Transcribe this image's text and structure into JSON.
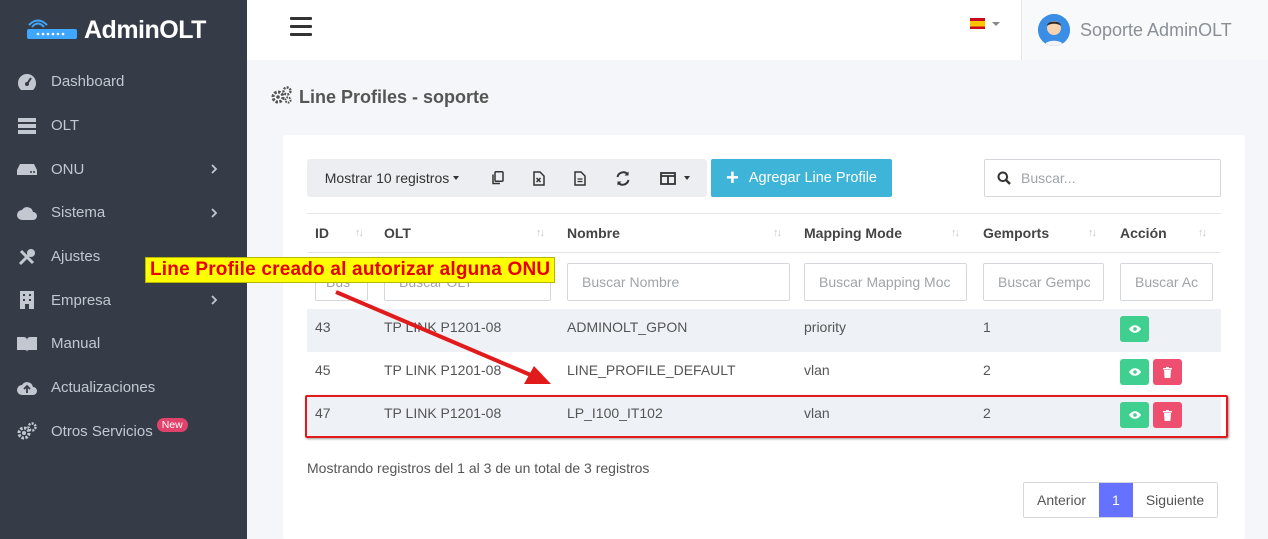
{
  "brand": {
    "name": "AdminOLT"
  },
  "sidebar": {
    "items": [
      {
        "label": "Dashboard",
        "icon": "dashboard-icon",
        "has_children": false
      },
      {
        "label": "OLT",
        "icon": "server-icon",
        "has_children": false
      },
      {
        "label": "ONU",
        "icon": "router-icon",
        "has_children": true
      },
      {
        "label": "Sistema",
        "icon": "cloud-icon",
        "has_children": true
      },
      {
        "label": "Ajustes",
        "icon": "tools-icon",
        "has_children": false
      },
      {
        "label": "Empresa",
        "icon": "building-icon",
        "has_children": true
      },
      {
        "label": "Manual",
        "icon": "book-icon",
        "has_children": false
      },
      {
        "label": "Actualizaciones",
        "icon": "cloud-upload-icon",
        "has_children": false
      },
      {
        "label": "Otros Servicios",
        "icon": "cogs-icon",
        "has_children": false,
        "badge": "New"
      }
    ]
  },
  "header": {
    "language": "es",
    "user_name": "Soporte AdminOLT"
  },
  "page": {
    "title": "Line Profiles - soporte"
  },
  "toolbar": {
    "show_records": "Mostrar 10 registros",
    "add_button": "Agregar Line Profile",
    "search_placeholder": "Buscar..."
  },
  "table": {
    "columns": [
      "ID",
      "OLT",
      "Nombre",
      "Mapping Mode",
      "Gemports",
      "Acción"
    ],
    "filters": [
      "Bus",
      "Buscar OLT",
      "Buscar Nombre",
      "Buscar Mapping Moc",
      "Buscar Gempc",
      "Buscar Ac"
    ],
    "rows": [
      {
        "id": "43",
        "olt": "TP LINK P1201-08",
        "nombre": "ADMINOLT_GPON",
        "mapping": "priority",
        "gemports": "1",
        "can_delete": false
      },
      {
        "id": "45",
        "olt": "TP LINK P1201-08",
        "nombre": "LINE_PROFILE_DEFAULT",
        "mapping": "vlan",
        "gemports": "2",
        "can_delete": true
      },
      {
        "id": "47",
        "olt": "TP LINK P1201-08",
        "nombre": "LP_I100_IT102",
        "mapping": "vlan",
        "gemports": "2",
        "can_delete": true
      }
    ]
  },
  "footer": {
    "info": "Mostrando registros del 1 al 3 de un total de 3 registros",
    "prev": "Anterior",
    "page": "1",
    "next": "Siguiente"
  },
  "annotation": {
    "text": "Line Profile creado al autorizar alguna ONU"
  },
  "colors": {
    "sidebar": "#353c48",
    "accent": "#3eb5d8",
    "view": "#3fcf8e",
    "delete": "#ef4f6f",
    "pager_active": "#6571ff",
    "annotation_bg": "#ffff00",
    "annotation_fg": "#e60000"
  }
}
